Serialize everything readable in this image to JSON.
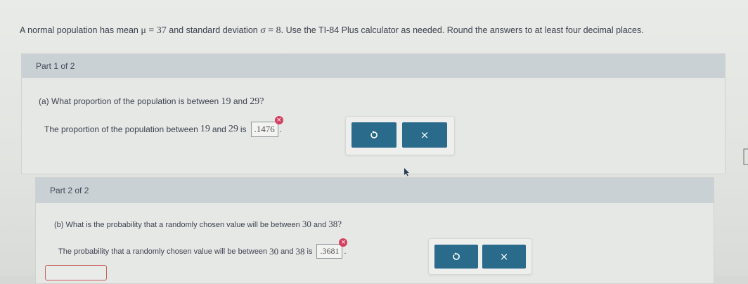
{
  "problem": {
    "prefix": "A normal population has mean",
    "mu_expr": "μ = 37",
    "middle": "and standard deviation",
    "sigma_expr": "σ = 8.",
    "suffix": "Use the TI-84 Plus calculator as needed. Round the answers to at least four decimal places."
  },
  "part1": {
    "header": "Part 1 of 2",
    "question_prefix": "(a) What proportion of the population is between",
    "a": "19",
    "and": "and",
    "b": "29?",
    "answer_prefix": "The proportion of the population between",
    "ans_a": "19",
    "ans_and": "and",
    "ans_b": "29",
    "ans_is": "is",
    "answer_value": ".1476",
    "period": ".",
    "error_mark": "×",
    "close_symbol": "×"
  },
  "part2": {
    "header": "Part 2 of 2",
    "question_prefix": "(b) What is the probability that a randomly chosen value will be between",
    "a": "30",
    "and": "and",
    "b": "38?",
    "answer_prefix": "The probability that a randomly chosen value will be between",
    "ans_a": "30",
    "ans_and": "and",
    "ans_b": "38",
    "ans_is": "is",
    "answer_value": ".3681",
    "period": ".",
    "error_mark": "×",
    "close_symbol": "×"
  },
  "colors": {
    "button": "#2a6a8a",
    "header": "#c9d1d4",
    "error": "#d2405f"
  },
  "icons": {
    "undo": "undo-icon",
    "close": "close-icon",
    "error": "error-badge-icon",
    "cursor": "mouse-cursor-icon"
  }
}
